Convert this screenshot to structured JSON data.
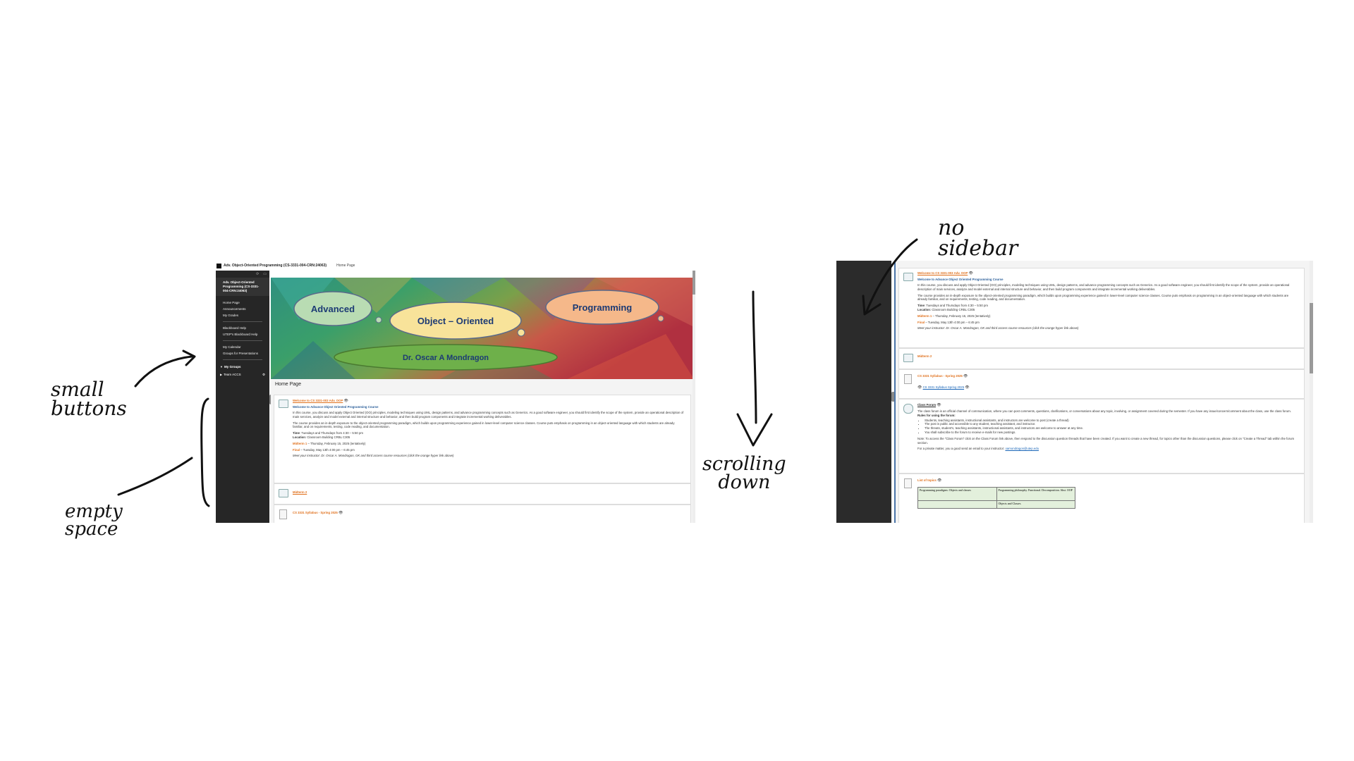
{
  "left_screenshot": {
    "topbar": {
      "course_title": "Adv. Object-Oriented Programming (CS-3331-004-CRN:24063)",
      "breadcrumb": "Home Page"
    },
    "sidebar": {
      "course_title": "Adv. Object-Oriented Programming (CS-3331-004-CRN:24063)",
      "items": [
        "Home Page",
        "Announcements",
        "My Grades"
      ],
      "help_items": [
        "Blackboard Help",
        "UTEP's Blackboard Help"
      ],
      "extra_items": [
        "My Calendar",
        "Groups for Presentations"
      ],
      "my_groups_label": "My Groups",
      "team_label": "Team ACCS"
    },
    "banner": {
      "word1": "Advanced",
      "word2": "Object – Oriented",
      "word3": "Programming",
      "instructor": "Dr. Oscar A Mondragon"
    },
    "page_title": "Home Page",
    "welcome_card": {
      "link": "Welcome to CS 3331-003 Adv. OOP",
      "subtitle": "Welcome to Advance Object Oriented Programming Course",
      "para1": "In this course, you discuss and apply Object Oriented (OO) principles, modeling techniques using UML, design patterns, and advance programming concepts such as Generics. As a good software engineer, you should first identify the scope of the system, provide an operational description of main services, analyze and model external and internal structure and behavior, and then build program components and integrate incremental working deliverables.",
      "para2": "The course provides an in-depth exposure to the object-oriented programming paradigm, which builds upon programming experience gained in lower-level computer science classes. Course puts emphasis on programming in an object-oriented language with which students are already familiar, and on requirements, testing, code reading, and documentation.",
      "time_label": "Time",
      "time_value": ": Tuesdays and Thursdays from 4:30 – 5:50 pm",
      "location_label": "Location",
      "location_value": ": Classroom Building CRBL C305",
      "midterm_label": "Midterm 1",
      "midterm_value": " – Thursday, February 15, 2025 (tentatively)",
      "final_label": "Final",
      "final_value": " – Tuesday, May 13th 4:00 pm – 6:45 pm",
      "meet_text": "Meet your instructor: Dr. Oscar A. Mondragon, OK and third access course resources (click the orange hyper link above)"
    },
    "midterm2_link": "Midterm 2",
    "syllabus_link": "CS 3331 Syllabus - Spring 2025"
  },
  "right_screenshot": {
    "welcome_card": {
      "link": "Welcome to CS 3331-003 Adv. OOP",
      "subtitle": "Welcome to Advance Object Oriented Programming Course",
      "para1": "In this course, you discuss and apply Object Oriented (OO) principles, modeling techniques using UML, design patterns, and advance programming concepts such as Generics. As a good software engineer, you should first identify the scope of the system, provide an operational description of main services, analyze and model external and internal structure and behavior, and then build program components and integrate incremental working deliverables.",
      "para2": "The course provides an in-depth exposure to the object-oriented programming paradigm, which builds upon programming experience gained in lower-level computer science classes. Course puts emphasis on programming in an object-oriented language with which students are already familiar, and on requirements, testing, code reading, and documentation.",
      "time_label": "Time",
      "time_value": ": Tuesdays and Thursdays from 4:30 – 5:50 pm",
      "location_label": "Location",
      "location_value": ": Classroom Building CRBL C305",
      "midterm_label": "Midterm 1",
      "midterm_value": " – Thursday, February 15, 2025 (tentatively)",
      "final_label": "Final",
      "final_value": " – Tuesday, May 13th 4:00 pm – 6:45 pm",
      "meet_text": "Meet your instructor: Dr. Oscar A. Mondragon, OK and third access course resources (click the orange hyper link above)"
    },
    "midterm2_link": "Midterm 2",
    "syllabus_link": "CS 3331 Syllabus - Spring 2025",
    "syllabus_file": "CS 3331 Syllabus Spring 2025",
    "forum": {
      "link": "Class Forum",
      "intro": "The class forum is an official channel of communication, where you can post comments, questions, clarifications, or conversations about any topic, involving, or assignment covered during the semester. If you have any issue/concern/comment about the class, use the class forum.",
      "rules_title": "Rules for using the forum:",
      "rules": [
        "Students, teaching assistants, instructional assistants, and instructors are welcome to post (create a thread)",
        "The post is public and accessible to any student, teaching assistant, and instructor.",
        "The threats, student's, teaching assistants, instructional assistants, and instructors are welcome to answer at any time.",
        "You shall subscribe to the forum to receive e-mails for new postings."
      ],
      "note": "Note: To access the \"Class Forum\" click on the Class Forum link above, then respond to the discussion question threads that have been created. If you want to create a new thread, for topics other than the discussion questions, please click on \"Create a Thread\" tab within the forum section.",
      "private_matter": "For a private matter, you a good send an email to your instructor:",
      "email": "oamondragon@utep.edu"
    },
    "list_of_topics": {
      "link": "List of topics",
      "cells": [
        "Programming paradigms: Objects and classes",
        "Programming philosophy. Functional. Decomposition. Abst. OOP",
        "",
        "Objects and Classes"
      ]
    }
  },
  "annotations": {
    "small_buttons": "small\nbuttons",
    "empty_space": "empty\nspace",
    "scrolling_down": "scrolling\ndown",
    "no_sidebar": "no\nsidebar"
  },
  "colors": {
    "sidebar_bg": "#262626",
    "link_orange": "#e0701c",
    "link_blue": "#1a66b8",
    "content_bg": "#f4f4f4",
    "cloud_green": "#b9dcb3",
    "cloud_yellow": "#f8e39a",
    "cloud_peach": "#f5b88a",
    "ribbon_green": "#6eb04a"
  },
  "icons": [
    "folder-icon",
    "document-icon",
    "eye-icon",
    "collapse-arrow-icon",
    "gear-icon"
  ]
}
